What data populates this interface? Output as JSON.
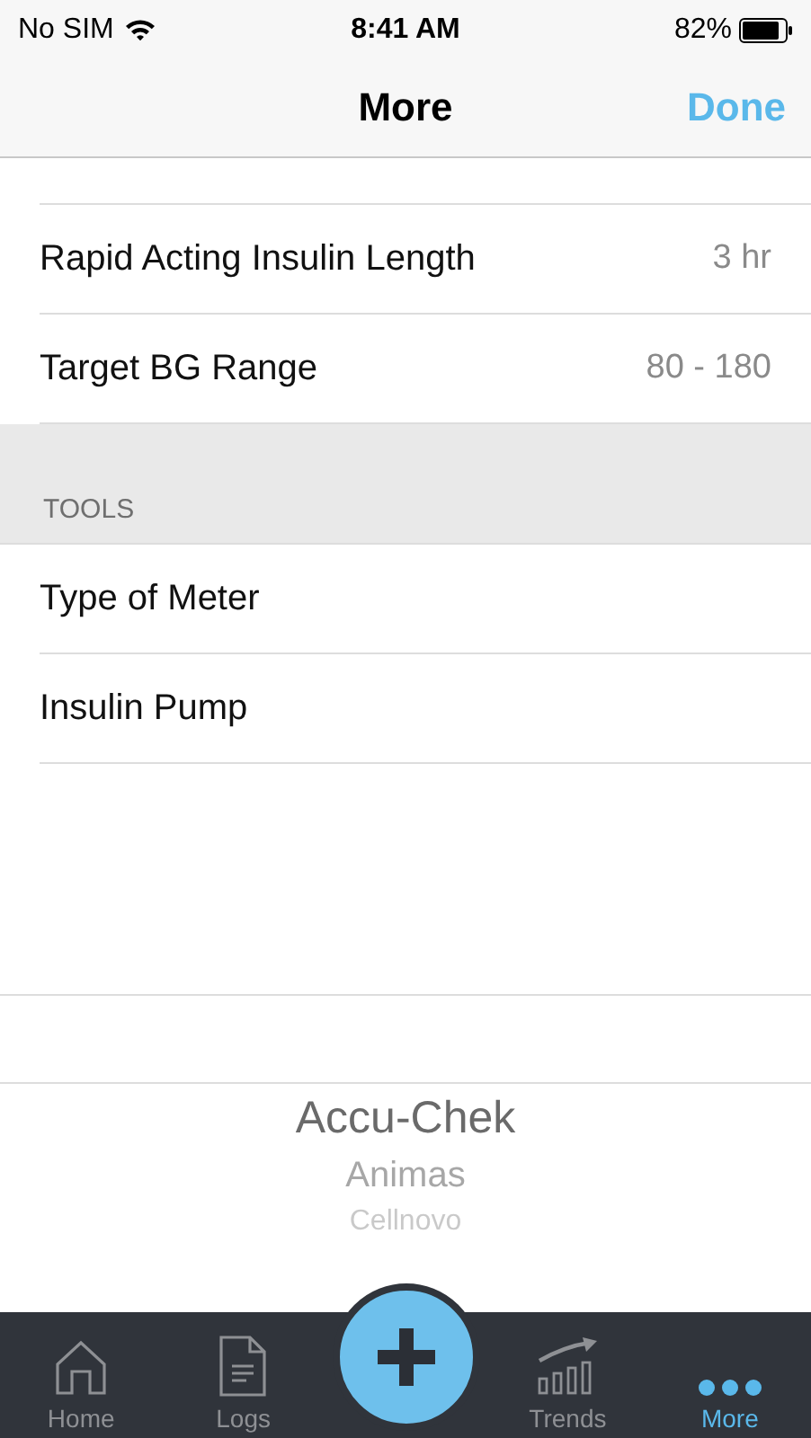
{
  "status_bar": {
    "carrier": "No SIM",
    "time": "8:41 AM",
    "battery": "82%"
  },
  "nav": {
    "title": "More",
    "done": "Done"
  },
  "sections": [
    {
      "rows": [
        {
          "label": "Rapid Acting Insulin Length",
          "value": "3 hr"
        },
        {
          "label": "Target BG Range",
          "value": "80 - 180"
        }
      ]
    },
    {
      "header": "TOOLS",
      "rows": [
        {
          "label": "Type of Meter"
        },
        {
          "label": "Insulin Pump"
        }
      ]
    }
  ],
  "picker": {
    "items": [
      {
        "label": "Accu-Chek",
        "selected": true
      },
      {
        "label": "Animas",
        "selected": false
      },
      {
        "label": "Cellnovo",
        "selected": false
      }
    ]
  },
  "tabs": [
    {
      "label": "Home",
      "kind": "home",
      "selected": false
    },
    {
      "label": "Logs",
      "kind": "logs",
      "selected": false
    },
    {
      "kind": "add"
    },
    {
      "label": "Trends",
      "kind": "trends",
      "selected": false
    },
    {
      "label": "More",
      "kind": "more",
      "selected": true
    }
  ]
}
